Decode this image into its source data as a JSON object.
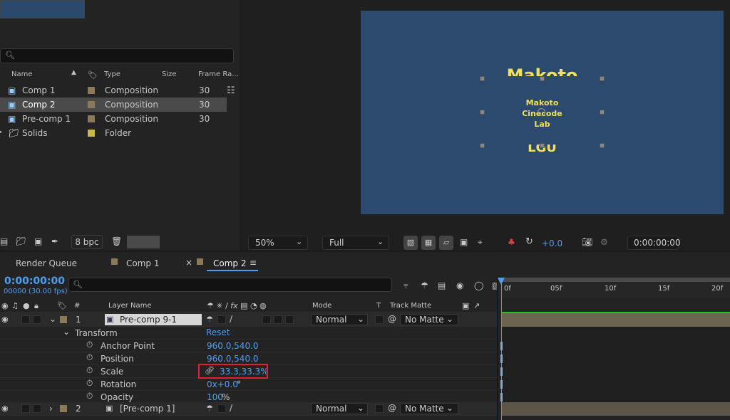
{
  "project": {
    "search_placeholder": "",
    "columns": {
      "name": "Name",
      "type": "Type",
      "size": "Size",
      "frame_rate": "Frame Ra..."
    },
    "items": [
      {
        "name": "Comp 1",
        "type": "Composition",
        "fps": "30",
        "color": "#8a7a5a",
        "selected": false
      },
      {
        "name": "Comp 2",
        "type": "Composition",
        "fps": "30",
        "color": "#8a7a5a",
        "selected": true
      },
      {
        "name": "Pre-comp 1",
        "type": "Composition",
        "fps": "30",
        "color": "#8a7a5a",
        "selected": false
      },
      {
        "name": "Solids",
        "type": "Folder",
        "fps": "",
        "color": "#c9b94a",
        "selected": false
      }
    ],
    "bpc": "8 bpc"
  },
  "viewer": {
    "text_top": "Makoto",
    "text_middle_1": "Makoto",
    "text_middle_2": "Cinecode",
    "text_middle_3": "Lab",
    "text_bottom": "LGU",
    "zoom": "50%",
    "resolution": "Full",
    "exposure": "+0.0",
    "timecode": "0:00:00:00",
    "text_color": "#f2df5c",
    "bg_color": "#2c4a6e"
  },
  "timeline": {
    "tabs": [
      {
        "label": "Render Queue"
      },
      {
        "label": "Comp 1"
      },
      {
        "label": "Comp 2"
      }
    ],
    "current_time": "0:00:00:00",
    "frame_info": "00000 (30.00 fps)",
    "column_headers": {
      "hash": "#",
      "layer_name": "Layer Name",
      "mode": "Mode",
      "t": "T",
      "track_matte": "Track Matte"
    },
    "ruler": [
      "0f",
      "05f",
      "10f",
      "15f",
      "20f"
    ],
    "layers": [
      {
        "index": "1",
        "name": "Pre-comp 9-1",
        "mode": "Normal",
        "matte": "No Matte"
      },
      {
        "index": "2",
        "name": "[Pre-comp 1]",
        "mode": "Normal",
        "matte": "No Matte"
      }
    ],
    "transform": {
      "label": "Transform",
      "reset": "Reset",
      "props": [
        {
          "label": "Anchor Point",
          "value": "960.0,540.0"
        },
        {
          "label": "Position",
          "value": "960.0,540.0"
        },
        {
          "label": "Scale",
          "value": "33.3,33.3%"
        },
        {
          "label": "Rotation",
          "value_blue": "0x+0.0",
          "suffix": "°"
        },
        {
          "label": "Opacity",
          "value_blue": "100",
          "suffix": "%"
        }
      ]
    },
    "highlight_color": "#e0202a"
  }
}
